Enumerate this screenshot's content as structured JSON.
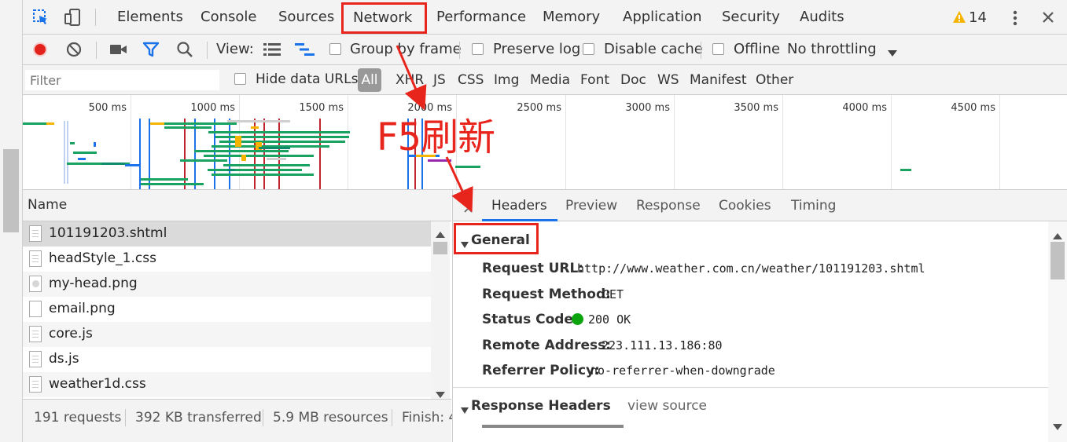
{
  "tabs": [
    "Elements",
    "Console",
    "Sources",
    "Network",
    "Performance",
    "Memory",
    "Application",
    "Security",
    "Audits"
  ],
  "warnings_count": "14",
  "toolbar": {
    "view_label": "View:",
    "group_by_frame": "Group by frame",
    "preserve_log": "Preserve log",
    "disable_cache": "Disable cache",
    "offline": "Offline",
    "throttling": "No throttling"
  },
  "filter": {
    "placeholder": "Filter",
    "hide_data_urls": "Hide data URLs",
    "types": [
      "All",
      "XHR",
      "JS",
      "CSS",
      "Img",
      "Media",
      "Font",
      "Doc",
      "WS",
      "Manifest",
      "Other"
    ]
  },
  "timeline_ticks": [
    "500 ms",
    "1000 ms",
    "1500 ms",
    "2000 ms",
    "2500 ms",
    "3000 ms",
    "3500 ms",
    "4000 ms",
    "4500 ms"
  ],
  "annotation_text": "F5刷新",
  "name_header": "Name",
  "requests": [
    "101191203.shtml",
    "headStyle_1.css",
    "my-head.png",
    "email.png",
    "core.js",
    "ds.js",
    "weather1d.css"
  ],
  "status": {
    "requests": "191 requests",
    "transferred": "392 KB transferred",
    "resources": "5.9 MB resources",
    "finish": "Finish: 4"
  },
  "detail_tabs": [
    "Headers",
    "Preview",
    "Response",
    "Cookies",
    "Timing"
  ],
  "general": {
    "title": "General",
    "request_url_label": "Request URL:",
    "request_url": "http://www.weather.com.cn/weather/101191203.shtml",
    "request_method_label": "Request Method:",
    "request_method": "GET",
    "status_code_label": "Status Code:",
    "status_code": "200 OK",
    "remote_address_label": "Remote Address:",
    "remote_address": "223.111.13.186:80",
    "referrer_policy_label": "Referrer Policy:",
    "referrer_policy": "no-referrer-when-downgrade"
  },
  "response_headers": {
    "title": "Response Headers",
    "view_source": "view source"
  },
  "colors": {
    "record": "#e3221c",
    "accent": "#1a73e8",
    "annotation": "#e8251c",
    "status_green": "#0ca40c",
    "warning": "#f4b400"
  }
}
